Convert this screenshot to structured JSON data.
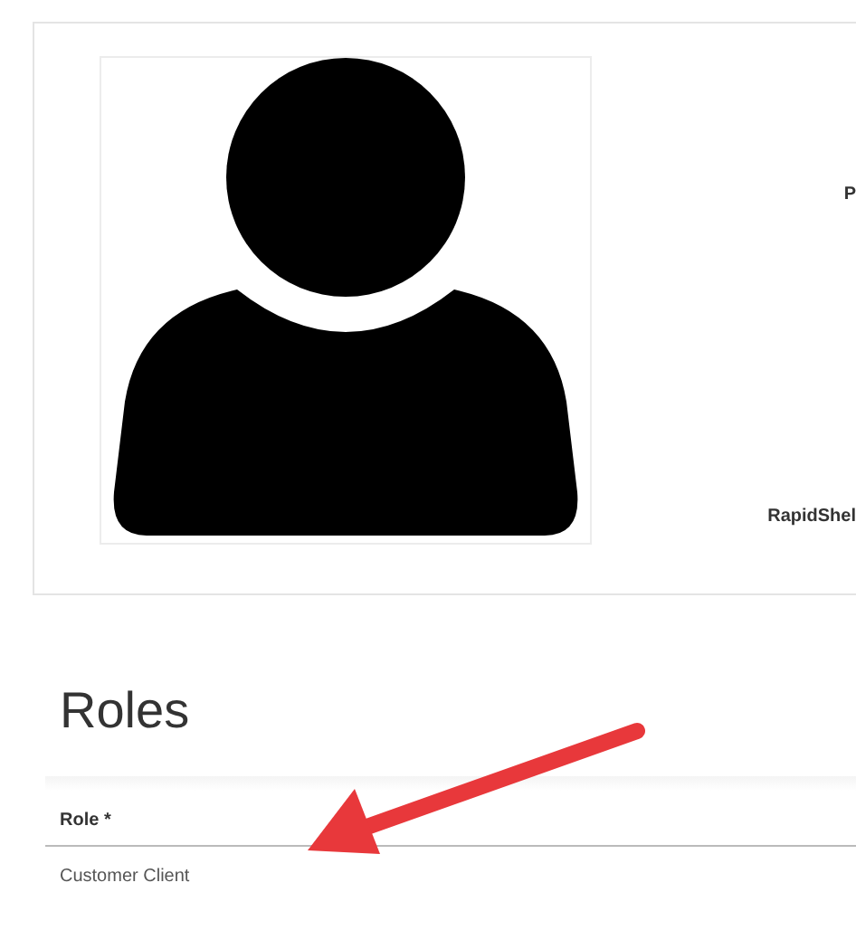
{
  "profile": {
    "fields": [
      {
        "label": "P"
      },
      {
        "label": "RapidShel"
      }
    ]
  },
  "roles": {
    "title": "Roles",
    "columns": [
      "Role *"
    ],
    "rows": [
      [
        "Customer Client"
      ]
    ]
  }
}
